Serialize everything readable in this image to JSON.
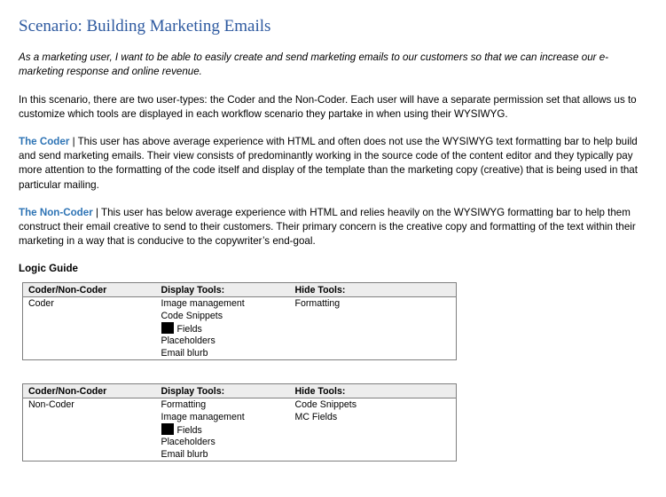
{
  "document": {
    "title": "Scenario: Building Marketing Emails",
    "user_story": "As a marketing user, I want to be able to easily create and send marketing emails to our customers so that we can increase our e-marketing response and online revenue.",
    "intro": "In this scenario, there are two user-types: the Coder and the Non-Coder. Each user will have a separate permission set that allows us to customize which tools are displayed in each workflow scenario they partake in when using their WYSIWYG.",
    "coder": {
      "term": "The Coder",
      "separator": " | ",
      "text": "This user has above average experience with HTML and often does not use the WYSIWYG text formatting bar to help build and send marketing emails. Their view consists of predominantly working in the source code of the content editor and they typically pay more attention to the formatting of the code itself and display of the template than the marketing copy (creative) that is being used in that particular mailing."
    },
    "non_coder": {
      "term": "The Non-Coder",
      "separator": " | ",
      "text": "This user has below average experience with HTML and relies heavily on the WYSIWYG formatting bar to help them construct their email creative to send to their customers. Their primary concern is the creative copy and formatting of the text within their marketing in a way that is conducive to the copywriter’s end-goal."
    },
    "logic_guide_heading": "Logic Guide"
  },
  "tables": [
    {
      "headers": [
        "Coder/Non-Coder",
        "Display Tools:",
        "Hide Tools:"
      ],
      "user_type": "Coder",
      "display_tools": [
        "Image management",
        "Code Snippets",
        "Fields",
        "Placeholders",
        "Email blurb"
      ],
      "hide_tools": [
        "Formatting"
      ]
    },
    {
      "headers": [
        "Coder/Non-Coder",
        "Display Tools:",
        "Hide Tools:"
      ],
      "user_type": "Non-Coder",
      "display_tools": [
        "Formatting",
        "Image management",
        "Fields",
        "Placeholders",
        "Email blurb"
      ],
      "hide_tools": [
        "Code Snippets",
        "MC Fields"
      ]
    }
  ]
}
